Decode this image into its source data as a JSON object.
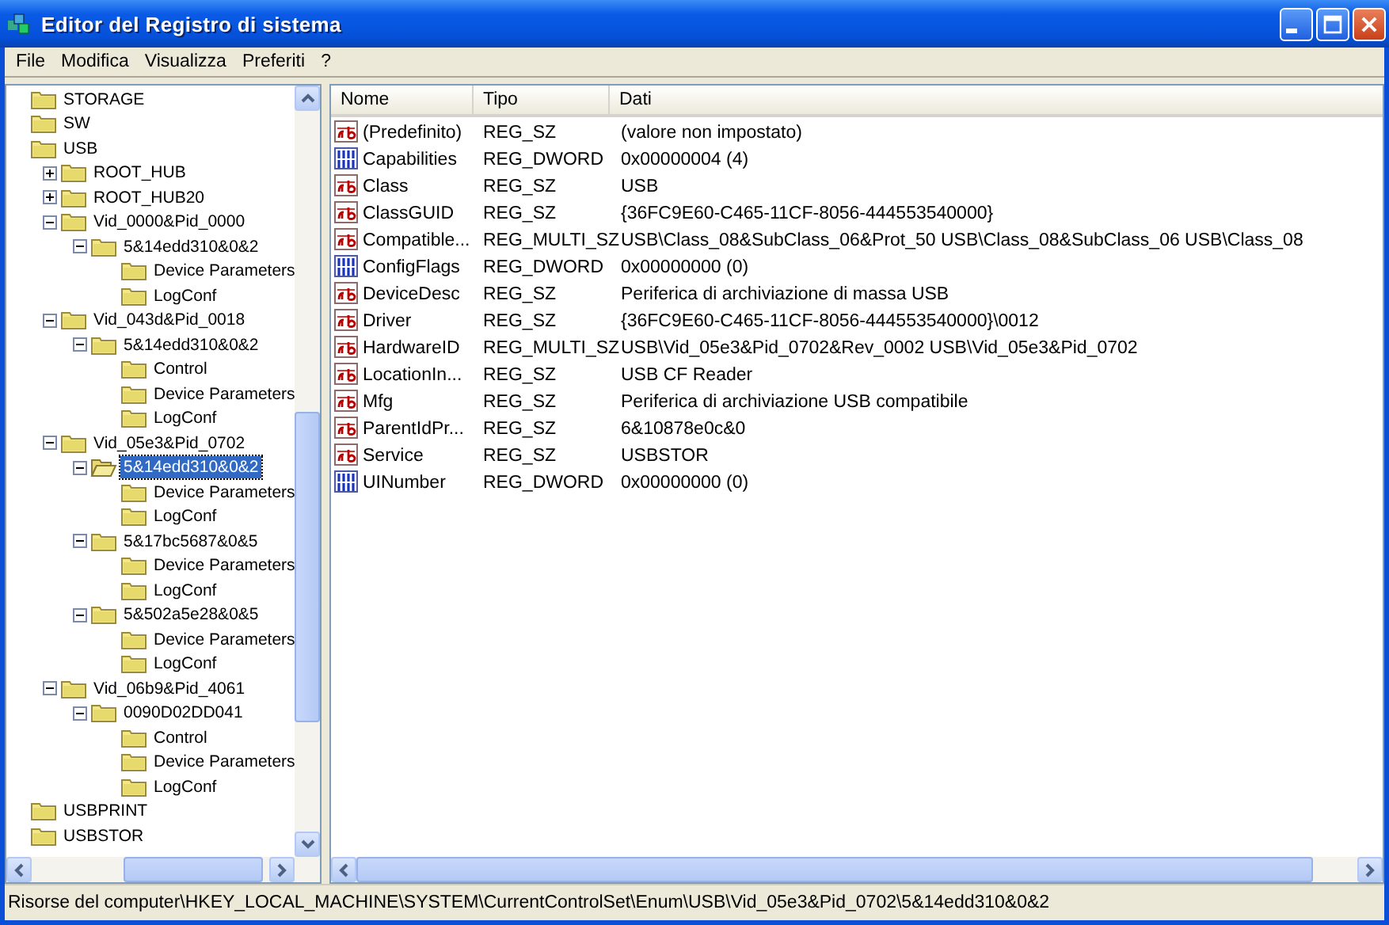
{
  "window": {
    "title": "Editor del Registro di sistema"
  },
  "menu": [
    "File",
    "Modifica",
    "Visualizza",
    "Preferiti",
    "?"
  ],
  "tree": [
    {
      "label": "STORAGE",
      "selected": false
    },
    {
      "label": "SW",
      "selected": false
    },
    {
      "label": "USB",
      "selected": false,
      "children": [
        {
          "label": "ROOT_HUB",
          "selected": false,
          "expanded": false
        },
        {
          "label": "ROOT_HUB20",
          "selected": false,
          "expanded": false
        },
        {
          "label": "Vid_0000&Pid_0000",
          "selected": false,
          "expanded": true,
          "children": [
            {
              "label": "5&14edd310&0&2",
              "selected": false,
              "expanded": true,
              "children": [
                {
                  "label": "Device Parameters",
                  "selected": false
                },
                {
                  "label": "LogConf",
                  "selected": false
                }
              ]
            }
          ]
        },
        {
          "label": "Vid_043d&Pid_0018",
          "selected": false,
          "expanded": true,
          "children": [
            {
              "label": "5&14edd310&0&2",
              "selected": false,
              "expanded": true,
              "children": [
                {
                  "label": "Control",
                  "selected": false
                },
                {
                  "label": "Device Parameters",
                  "selected": false
                },
                {
                  "label": "LogConf",
                  "selected": false
                }
              ]
            }
          ]
        },
        {
          "label": "Vid_05e3&Pid_0702",
          "selected": false,
          "expanded": true,
          "children": [
            {
              "label": "5&14edd310&0&2",
              "selected": true,
              "expanded": true,
              "children": [
                {
                  "label": "Device Parameters",
                  "selected": false
                },
                {
                  "label": "LogConf",
                  "selected": false
                }
              ]
            },
            {
              "label": "5&17bc5687&0&5",
              "selected": false,
              "expanded": true,
              "children": [
                {
                  "label": "Device Parameters",
                  "selected": false
                },
                {
                  "label": "LogConf",
                  "selected": false
                }
              ]
            },
            {
              "label": "5&502a5e28&0&5",
              "selected": false,
              "expanded": true,
              "children": [
                {
                  "label": "Device Parameters",
                  "selected": false
                },
                {
                  "label": "LogConf",
                  "selected": false
                }
              ]
            }
          ]
        },
        {
          "label": "Vid_06b9&Pid_4061",
          "selected": false,
          "expanded": true,
          "children": [
            {
              "label": "0090D02DD041",
              "selected": false,
              "expanded": true,
              "children": [
                {
                  "label": "Control",
                  "selected": false
                },
                {
                  "label": "Device Parameters",
                  "selected": false
                },
                {
                  "label": "LogConf",
                  "selected": false
                }
              ]
            }
          ]
        }
      ]
    },
    {
      "label": "USBPRINT",
      "selected": false
    },
    {
      "label": "USBSTOR",
      "selected": false
    }
  ],
  "table": {
    "columns": [
      "Nome",
      "Tipo",
      "Dati"
    ],
    "rows": [
      {
        "kind": "string",
        "name": "(Predefinito)",
        "type": "REG_SZ",
        "data": "(valore non impostato)"
      },
      {
        "kind": "binary",
        "name": "Capabilities",
        "type": "REG_DWORD",
        "data": "0x00000004 (4)"
      },
      {
        "kind": "string",
        "name": "Class",
        "type": "REG_SZ",
        "data": "USB"
      },
      {
        "kind": "string",
        "name": "ClassGUID",
        "type": "REG_SZ",
        "data": "{36FC9E60-C465-11CF-8056-444553540000}"
      },
      {
        "kind": "string",
        "name": "Compatible...",
        "type": "REG_MULTI_SZ",
        "data": "USB\\Class_08&SubClass_06&Prot_50 USB\\Class_08&SubClass_06 USB\\Class_08"
      },
      {
        "kind": "binary",
        "name": "ConfigFlags",
        "type": "REG_DWORD",
        "data": "0x00000000 (0)"
      },
      {
        "kind": "string",
        "name": "DeviceDesc",
        "type": "REG_SZ",
        "data": "Periferica di archiviazione di massa USB"
      },
      {
        "kind": "string",
        "name": "Driver",
        "type": "REG_SZ",
        "data": "{36FC9E60-C465-11CF-8056-444553540000}\\0012"
      },
      {
        "kind": "string",
        "name": "HardwareID",
        "type": "REG_MULTI_SZ",
        "data": "USB\\Vid_05e3&Pid_0702&Rev_0002 USB\\Vid_05e3&Pid_0702"
      },
      {
        "kind": "string",
        "name": "LocationIn...",
        "type": "REG_SZ",
        "data": "USB CF Reader"
      },
      {
        "kind": "string",
        "name": "Mfg",
        "type": "REG_SZ",
        "data": "Periferica di archiviazione USB compatibile"
      },
      {
        "kind": "string",
        "name": "ParentIdPr...",
        "type": "REG_SZ",
        "data": "6&10878e0c&0"
      },
      {
        "kind": "string",
        "name": "Service",
        "type": "REG_SZ",
        "data": "USBSTOR"
      },
      {
        "kind": "binary",
        "name": "UINumber",
        "type": "REG_DWORD",
        "data": "0x00000000 (0)"
      }
    ]
  },
  "status_bar": "Risorse del computer\\HKEY_LOCAL_MACHINE\\SYSTEM\\CurrentControlSet\\Enum\\USB\\Vid_05e3&Pid_0702\\5&14edd310&0&2"
}
